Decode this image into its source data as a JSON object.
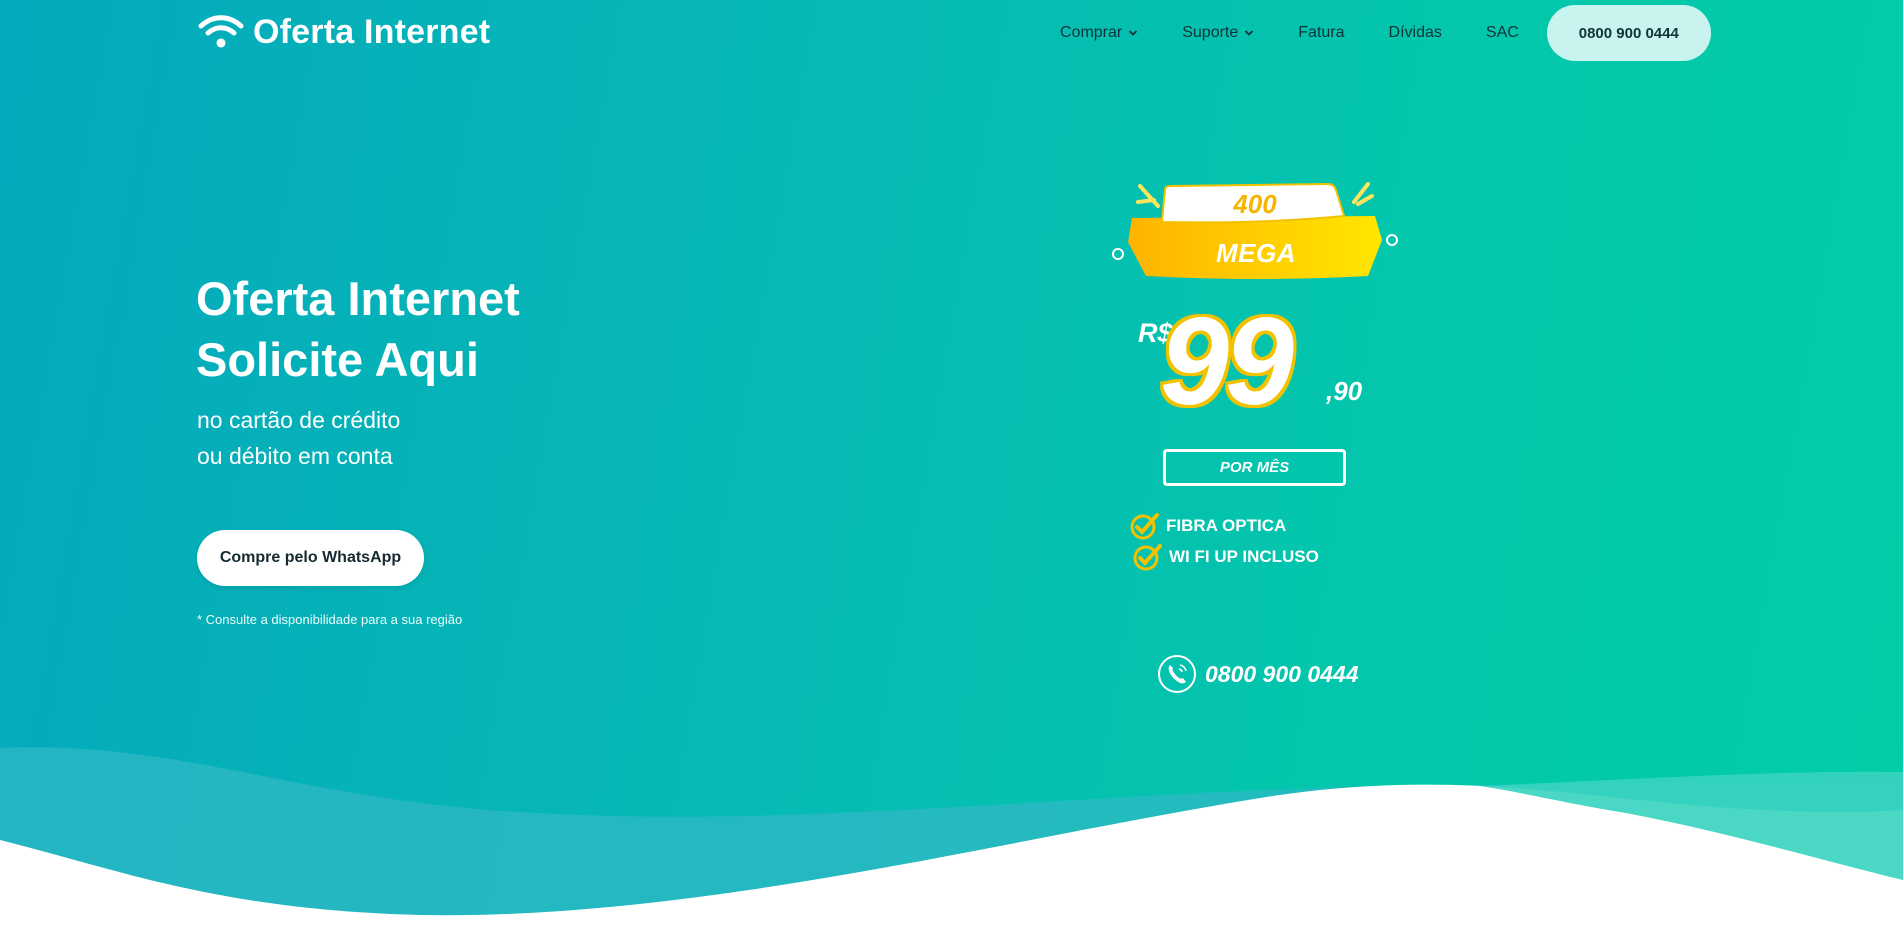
{
  "brand": {
    "name": "Oferta Internet"
  },
  "nav": {
    "items": [
      {
        "label": "Comprar",
        "has_dropdown": true
      },
      {
        "label": "Suporte",
        "has_dropdown": true
      },
      {
        "label": "Fatura",
        "has_dropdown": false
      },
      {
        "label": "Dívidas",
        "has_dropdown": false
      },
      {
        "label": "SAC",
        "has_dropdown": false
      }
    ],
    "cta_phone": "0800 900 0444"
  },
  "hero": {
    "title_line1": "Oferta Internet",
    "title_line2": "Solicite Aqui",
    "subtitle_line1": "no cartão de crédito",
    "subtitle_line2": "ou débito em conta",
    "whatsapp_button": "Compre pelo WhatsApp",
    "note": "* Consulte a disponibilidade para a sua região"
  },
  "offer": {
    "speed": "400",
    "unit": "MEGA",
    "currency": "R$",
    "price_integer": "99",
    "price_cents": ",90",
    "period": "POR MÊS",
    "features": [
      "FIBRA OPTICA",
      "WI FI UP INCLUSO"
    ],
    "phone": "0800 900 0444"
  },
  "colors": {
    "gradient_start": "#04a9bd",
    "gradient_end": "#02cda6",
    "badge_yellow": "#ffc400",
    "cta_bg": "#c8f3ee",
    "nav_text": "#10333a"
  },
  "icons": {
    "logo": "wifi-icon",
    "nav_dropdown": "chevron-down-icon",
    "feature_bullet": "checkmark-icon",
    "phone": "phone-icon"
  }
}
